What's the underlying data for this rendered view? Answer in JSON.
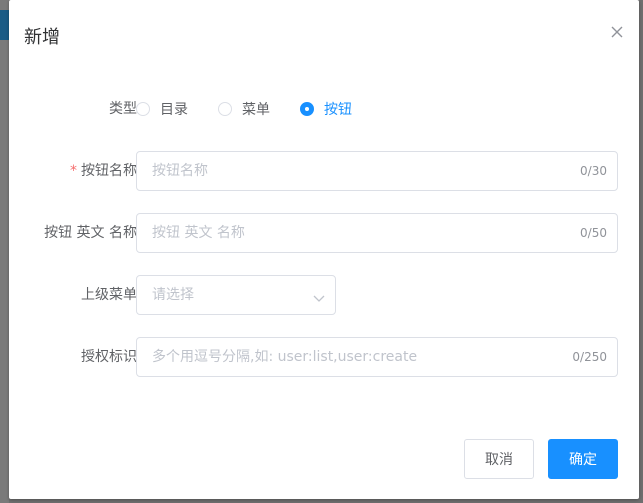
{
  "dialog": {
    "title": "新增",
    "close_icon": "close-icon"
  },
  "form": {
    "type": {
      "label": "类型",
      "options": [
        "目录",
        "菜单",
        "按钮"
      ],
      "selected": "按钮"
    },
    "button_name": {
      "label": "按钮名称",
      "required": "*",
      "placeholder": "按钮名称",
      "count": "0/30"
    },
    "button_en_name": {
      "label": "按钮 英文 名称",
      "placeholder": "按钮 英文 名称",
      "count": "0/50"
    },
    "parent_menu": {
      "label": "上级菜单",
      "placeholder": "请选择",
      "icon": "chevron-down-icon"
    },
    "permission": {
      "label": "授权标识",
      "placeholder": "多个用逗号分隔,如: user:list,user:create",
      "count": "0/250"
    }
  },
  "footer": {
    "cancel_label": "取消",
    "ok_label": "确定"
  },
  "colors": {
    "primary": "#1890ff",
    "required": "#f56c6c",
    "border": "#dcdfe6",
    "placeholder": "#c0c4cc"
  }
}
